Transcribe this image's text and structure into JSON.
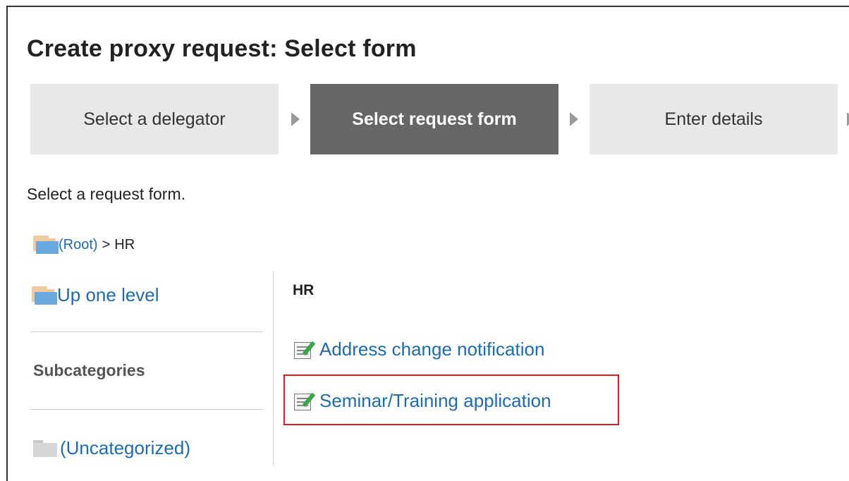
{
  "page": {
    "title": "Create proxy request: Select form",
    "instruction": "Select a request form."
  },
  "steps": [
    {
      "label": "Select a delegator",
      "active": false
    },
    {
      "label": "Select request form",
      "active": true
    },
    {
      "label": "Enter details",
      "active": false
    }
  ],
  "breadcrumb": {
    "root_label": "(Root)",
    "separator": ">",
    "current": "HR"
  },
  "sidebar": {
    "up_level_label": "Up one level",
    "subcategories_title": "Subcategories",
    "subcategories": [
      {
        "label": "(Uncategorized)"
      }
    ]
  },
  "main": {
    "category_title": "HR",
    "forms": [
      {
        "label": "Address change notification",
        "highlighted": false
      },
      {
        "label": "Seminar/Training application",
        "highlighted": true
      }
    ]
  },
  "colors": {
    "link": "#1a6bb8",
    "active_step_bg": "#666666",
    "inactive_step_bg": "#e8e8e8",
    "highlight_border": "#e01e1e"
  },
  "icons": {
    "folder": "folder-open-icon",
    "form": "form-edit-icon",
    "gray_folder": "folder-gray-icon",
    "step_arrow": "triangle-right-icon"
  }
}
